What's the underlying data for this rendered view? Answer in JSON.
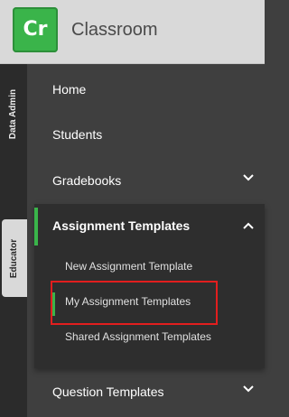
{
  "header": {
    "logo_text": "Cr",
    "app_title": "Classroom",
    "brand_color": "#3ab44a"
  },
  "rail": {
    "tabs": [
      {
        "label": "Data Admin",
        "active": false
      },
      {
        "label": "Educator",
        "active": true
      }
    ]
  },
  "nav": {
    "items": [
      {
        "label": "Home",
        "has_chevron": false
      },
      {
        "label": "Students",
        "has_chevron": false
      },
      {
        "label": "Gradebooks",
        "has_chevron": true,
        "chevron": "chevron-down-icon"
      },
      {
        "label": "Assignment Templates",
        "expanded": true,
        "chevron": "chevron-up-icon",
        "children": [
          {
            "label": "New Assignment Template",
            "selected": false
          },
          {
            "label": "My Assignment Templates",
            "selected": true
          },
          {
            "label": "Shared Assignment Templates",
            "selected": false
          }
        ]
      },
      {
        "label": "Question Templates",
        "has_chevron": true,
        "chevron": "chevron-down-icon"
      }
    ]
  },
  "highlight_color": "#e21e1e"
}
